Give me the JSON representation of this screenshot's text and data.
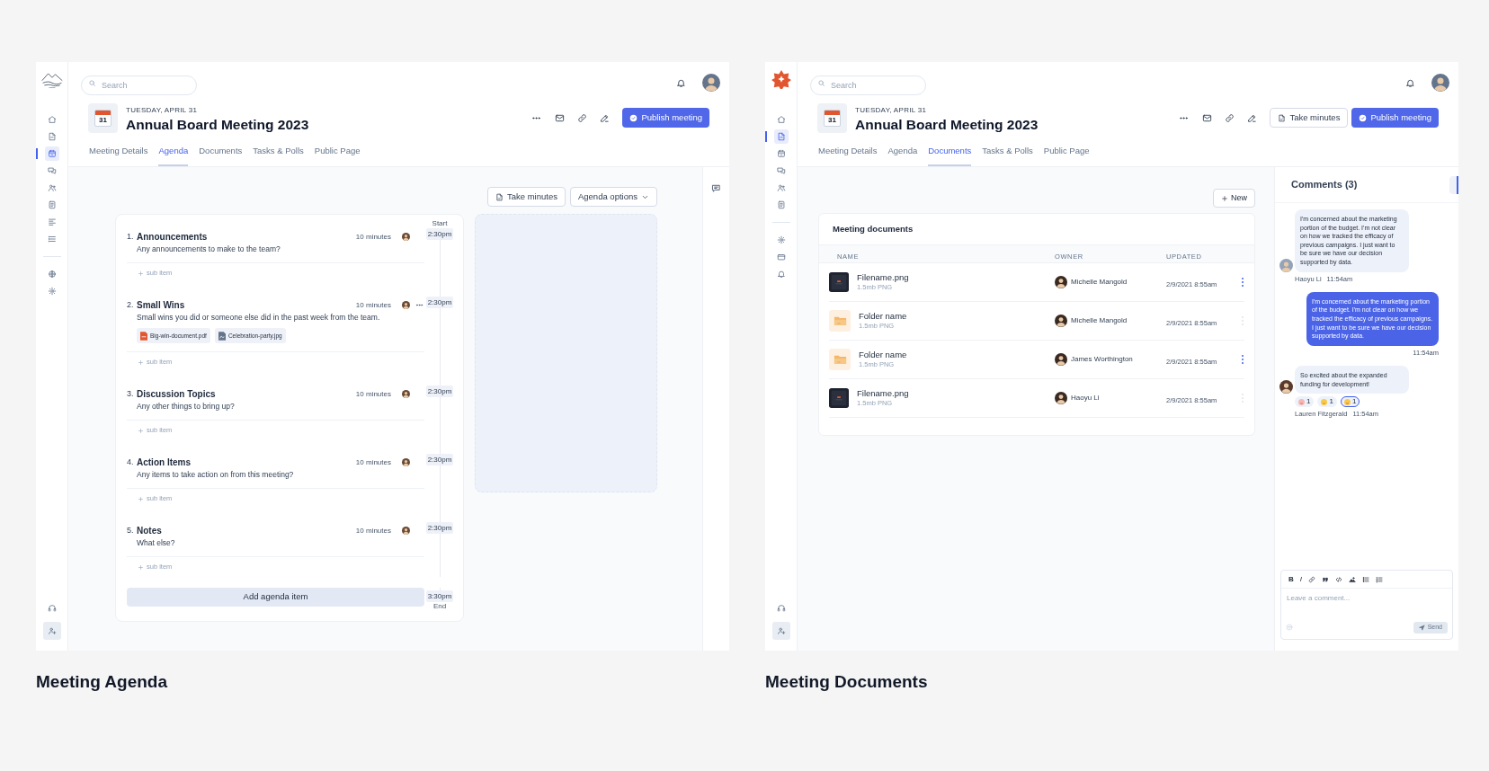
{
  "screens": [
    {
      "kind": "agenda",
      "caption": "Meeting Agenda",
      "sidebar": {
        "items": [
          {
            "selected": false
          },
          {
            "selected": false
          },
          {
            "selected": true
          },
          {
            "selected": false
          },
          {
            "selected": false
          },
          {
            "selected": false
          },
          {
            "selected": false
          },
          {
            "selected": false
          }
        ],
        "extra_items": [
          {
            "selected": false
          },
          {
            "selected": false
          }
        ]
      },
      "search": {
        "placeholder": "Search"
      },
      "meeting": {
        "day": "31",
        "date": "TUESDAY, APRIL 31",
        "title": "Annual Board Meeting 2023"
      },
      "actions": [
        {
          "kind": "publish",
          "label": "Publish meeting"
        }
      ],
      "tabs": [
        {
          "label": "Meeting Details",
          "selected": false
        },
        {
          "label": "Agenda",
          "selected": true
        },
        {
          "label": "Documents",
          "selected": false
        },
        {
          "label": "Tasks & Polls",
          "selected": false
        },
        {
          "label": "Public Page",
          "selected": false
        }
      ],
      "toolbar": [
        {
          "kind": "minutes",
          "label": "Take minutes"
        },
        {
          "kind": "dropdown",
          "label": "Agenda options"
        }
      ],
      "agenda": {
        "start_label": "Start",
        "end_time": "3:30pm",
        "end_label": "End",
        "add_label": "Add agenda item",
        "items": [
          {
            "number": "1.",
            "title": "Announcements",
            "description": "Any announcements to make to the team?",
            "duration": "10 minutes",
            "time": "2:30pm",
            "has_menu": false,
            "sub_item": "sub item"
          },
          {
            "number": "2.",
            "title": "Small Wins",
            "description": "Small wins you did or someone else did in the past week from the team.",
            "duration": "10 minutes",
            "time": "2:30pm",
            "has_menu": true,
            "sub_item": "sub item",
            "attachments": [
              {
                "kind": "pdf",
                "name": "Big-win-document.pdf"
              },
              {
                "kind": "image",
                "name": "Celebration-party.jpg"
              }
            ]
          },
          {
            "number": "3.",
            "title": "Discussion Topics",
            "description": "Any other things to bring up?",
            "duration": "10 minutes",
            "time": "2:30pm",
            "has_menu": false,
            "sub_item": "sub item"
          },
          {
            "number": "4.",
            "title": "Action Items",
            "description": "Any items to take action on from this meeting?",
            "duration": "10 minutes",
            "time": "2:30pm",
            "has_menu": false,
            "sub_item": "sub item"
          },
          {
            "number": "5.",
            "title": "Notes",
            "description": "What else?",
            "duration": "10 minutes",
            "time": "2:30pm",
            "has_menu": false,
            "sub_item": "sub item"
          }
        ]
      }
    },
    {
      "kind": "documents",
      "caption": "Meeting Documents",
      "sidebar": {
        "items": [
          {
            "selected": false
          },
          {
            "selected": true
          },
          {
            "selected": false
          },
          {
            "selected": false
          },
          {
            "selected": false
          },
          {
            "selected": false
          }
        ],
        "extra_items": [
          {
            "selected": false
          },
          {
            "selected": false
          },
          {
            "selected": false
          }
        ]
      },
      "search": {
        "placeholder": "Search"
      },
      "meeting": {
        "day": "31",
        "date": "TUESDAY, APRIL 31",
        "title": "Annual Board Meeting 2023"
      },
      "actions": [
        {
          "kind": "minutes",
          "label": "Take minutes"
        },
        {
          "kind": "publish",
          "label": "Publish meeting"
        }
      ],
      "tabs": [
        {
          "label": "Meeting Details",
          "selected": false
        },
        {
          "label": "Agenda",
          "selected": false
        },
        {
          "label": "Documents",
          "selected": true
        },
        {
          "label": "Tasks & Polls",
          "selected": false
        },
        {
          "label": "Public Page",
          "selected": false
        }
      ],
      "documents": {
        "new_label": "New",
        "title": "Meeting documents",
        "columns": [
          "NAME",
          "OWNER",
          "UPDATED"
        ],
        "rows": [
          {
            "kind": "image",
            "name": "Filename.png",
            "meta": "1.5mb PNG",
            "owner": "Michelle Mangold",
            "updated": "2/9/2021 8:55am",
            "menu_active": true
          },
          {
            "kind": "folder",
            "name": "Folder name",
            "meta": "1.5mb PNG",
            "owner": "Michelle Mangold",
            "updated": "2/9/2021 8:55am",
            "menu_active": false
          },
          {
            "kind": "folder",
            "name": "Folder name",
            "meta": "1.5mb PNG",
            "owner": "James Worthington",
            "updated": "2/9/2021 8:55am",
            "menu_active": true
          },
          {
            "kind": "image",
            "name": "Filename.png",
            "meta": "1.5mb PNG",
            "owner": "Haoyu Li",
            "updated": "2/9/2021 8:55am",
            "menu_active": false
          }
        ]
      },
      "comments": {
        "title": "Comments (3)",
        "messages": [
          {
            "kind": "incoming",
            "text": "I'm concerned about the marketing portion of the budget. I'm not clear on how we tracked the efficacy of previous campaigns. I just want to be sure we have our decision supported by data.",
            "author": "Haoyu Li",
            "time": "11:54am"
          },
          {
            "kind": "outgoing",
            "text": "I'm concerned about the marketing portion of the budget. I'm not clear on how we tracked the efficacy of previous campaigns. I just want to be sure we have our decision supported by data.",
            "time": "11:54am"
          },
          {
            "kind": "incoming",
            "text": "So excited about the expanded funding for development!",
            "author": "Lauren Fitzgerald",
            "time": "11:54am",
            "reactions": [
              {
                "count": "1",
                "selected": false
              },
              {
                "count": "1",
                "selected": false
              },
              {
                "count": "1",
                "selected": true
              }
            ]
          }
        ],
        "editor": {
          "format_labels": [
            "B",
            "I"
          ],
          "placeholder": "Leave a comment...",
          "send": {
            "label": "Send",
            "disabled": true
          }
        }
      }
    }
  ]
}
